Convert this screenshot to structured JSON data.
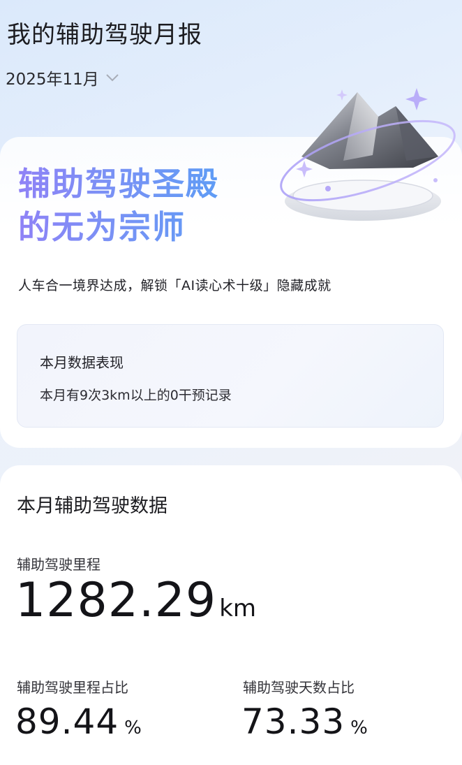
{
  "header": {
    "title": "我的辅助驾驶月报",
    "month": "2025年11月"
  },
  "hero": {
    "title_line1": "辅助驾驶圣殿",
    "title_line2": "的无为宗师",
    "subtitle": "人车合一境界达成，解锁「AI读心术十级」隐藏成就",
    "illustration_icon": "mountain-trophy-icon"
  },
  "monthly_box": {
    "title": "本月数据表现",
    "text": "本月有9次3km以上的0干预记录"
  },
  "stats": {
    "heading": "本月辅助驾驶数据",
    "mileage_label": "辅助驾驶里程",
    "mileage_value": "1282.29",
    "mileage_unit": "km",
    "mileage_ratio_label": "辅助驾驶里程占比",
    "mileage_ratio_value": "89.44",
    "mileage_ratio_unit": "%",
    "days_ratio_label": "辅助驾驶天数占比",
    "days_ratio_value": "73.33",
    "days_ratio_unit": "%"
  },
  "colors": {
    "title_gradient_start": "#8f82f6",
    "title_gradient_end": "#5f9cf5"
  }
}
